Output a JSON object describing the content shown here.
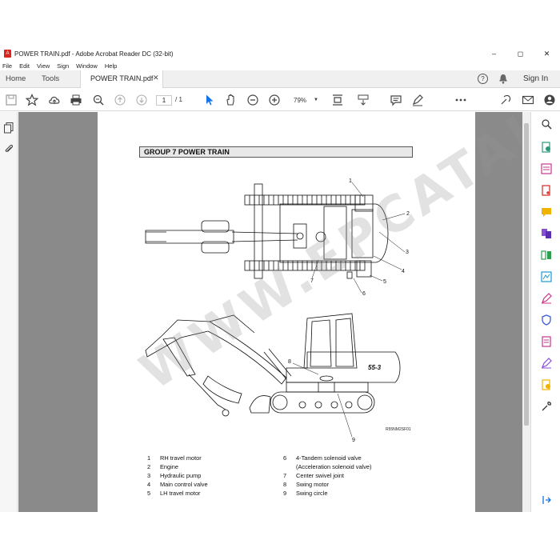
{
  "window": {
    "title": "POWER TRAIN.pdf - Adobe Acrobat Reader DC (32-bit)"
  },
  "menu": [
    "File",
    "Edit",
    "View",
    "Sign",
    "Window",
    "Help"
  ],
  "tabs": {
    "home": "Home",
    "tools": "Tools",
    "document": "POWER TRAIN.pdf"
  },
  "header": {
    "signin": "Sign In"
  },
  "toolbar": {
    "page_current": "1",
    "page_total": "/ 1",
    "zoom": "79%"
  },
  "page": {
    "group_title": "GROUP 7 POWER TRAIN",
    "figure_code": "R55NM2SF01",
    "watermark": "WWW.EPCATALO.COM",
    "callouts": [
      "1",
      "2",
      "3",
      "4",
      "5",
      "6",
      "7",
      "8",
      "9"
    ],
    "model_badge": "55-3",
    "legend_left": [
      {
        "num": "1",
        "text": "RH travel motor"
      },
      {
        "num": "2",
        "text": "Engine"
      },
      {
        "num": "3",
        "text": "Hydraulic pump"
      },
      {
        "num": "4",
        "text": "Main control valve"
      },
      {
        "num": "5",
        "text": "LH travel motor"
      }
    ],
    "legend_right": [
      {
        "num": "6",
        "text": "4-Tandem solenoid valve"
      },
      {
        "num": "",
        "text": "(Acceleration solenoid valve)"
      },
      {
        "num": "7",
        "text": "Center swivel joint"
      },
      {
        "num": "8",
        "text": "Swing motor"
      },
      {
        "num": "9",
        "text": "Swing circle"
      }
    ]
  },
  "colors": {
    "accent": "#1473e6",
    "brand": "#d6261d"
  }
}
